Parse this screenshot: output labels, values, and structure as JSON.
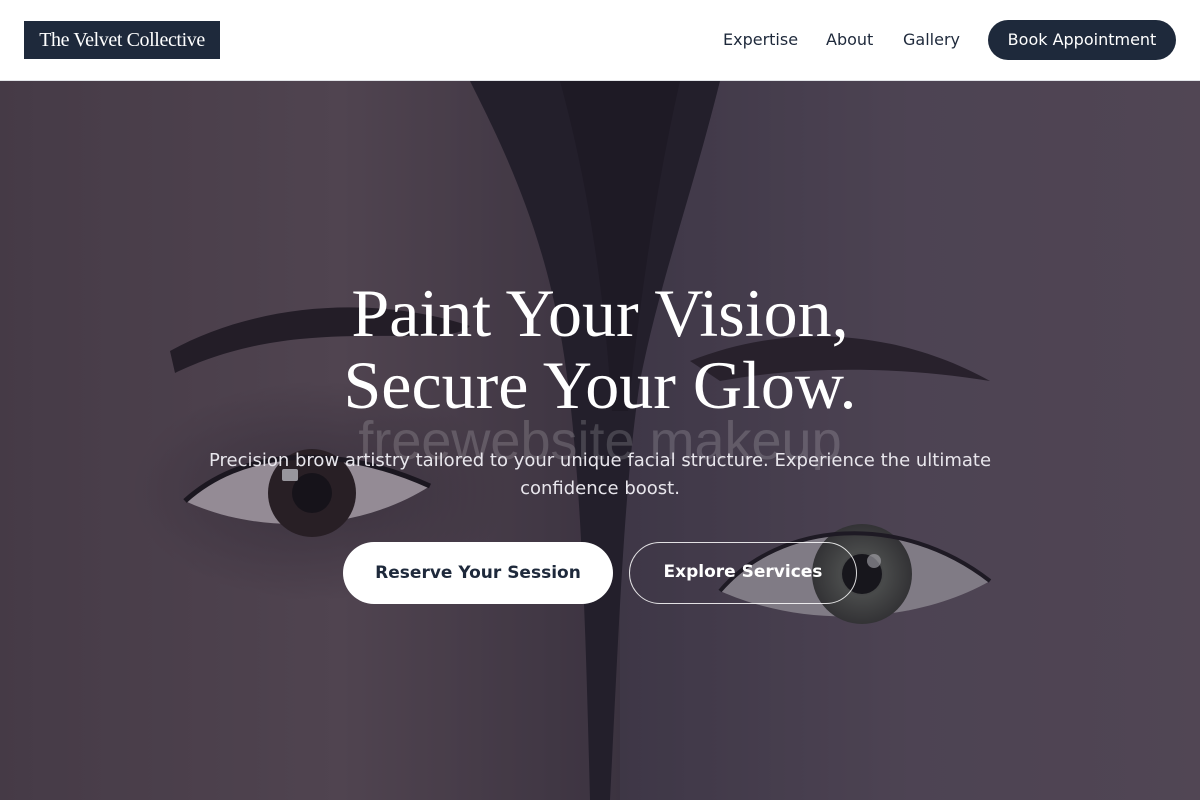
{
  "brand": {
    "name": "The Velvet Collective"
  },
  "nav": {
    "items": [
      {
        "label": "Expertise"
      },
      {
        "label": "About"
      },
      {
        "label": "Gallery"
      }
    ],
    "cta_label": "Book Appointment"
  },
  "hero": {
    "headline_line1": "Paint Your Vision,",
    "headline_line2": "Secure Your Glow.",
    "watermark": "freewebsite makeup",
    "subtitle": "Precision brow artistry tailored to your unique facial structure. Experience the ultimate confidence boost.",
    "primary_cta": "Reserve Your Session",
    "secondary_cta": "Explore Services"
  },
  "colors": {
    "brand_navy": "#1e293b",
    "header_bg": "#ffffff",
    "hero_overlay": "#262234",
    "primary_button_bg": "#ffffff",
    "primary_button_text": "#1e293b",
    "secondary_button_border": "#ffffff"
  }
}
